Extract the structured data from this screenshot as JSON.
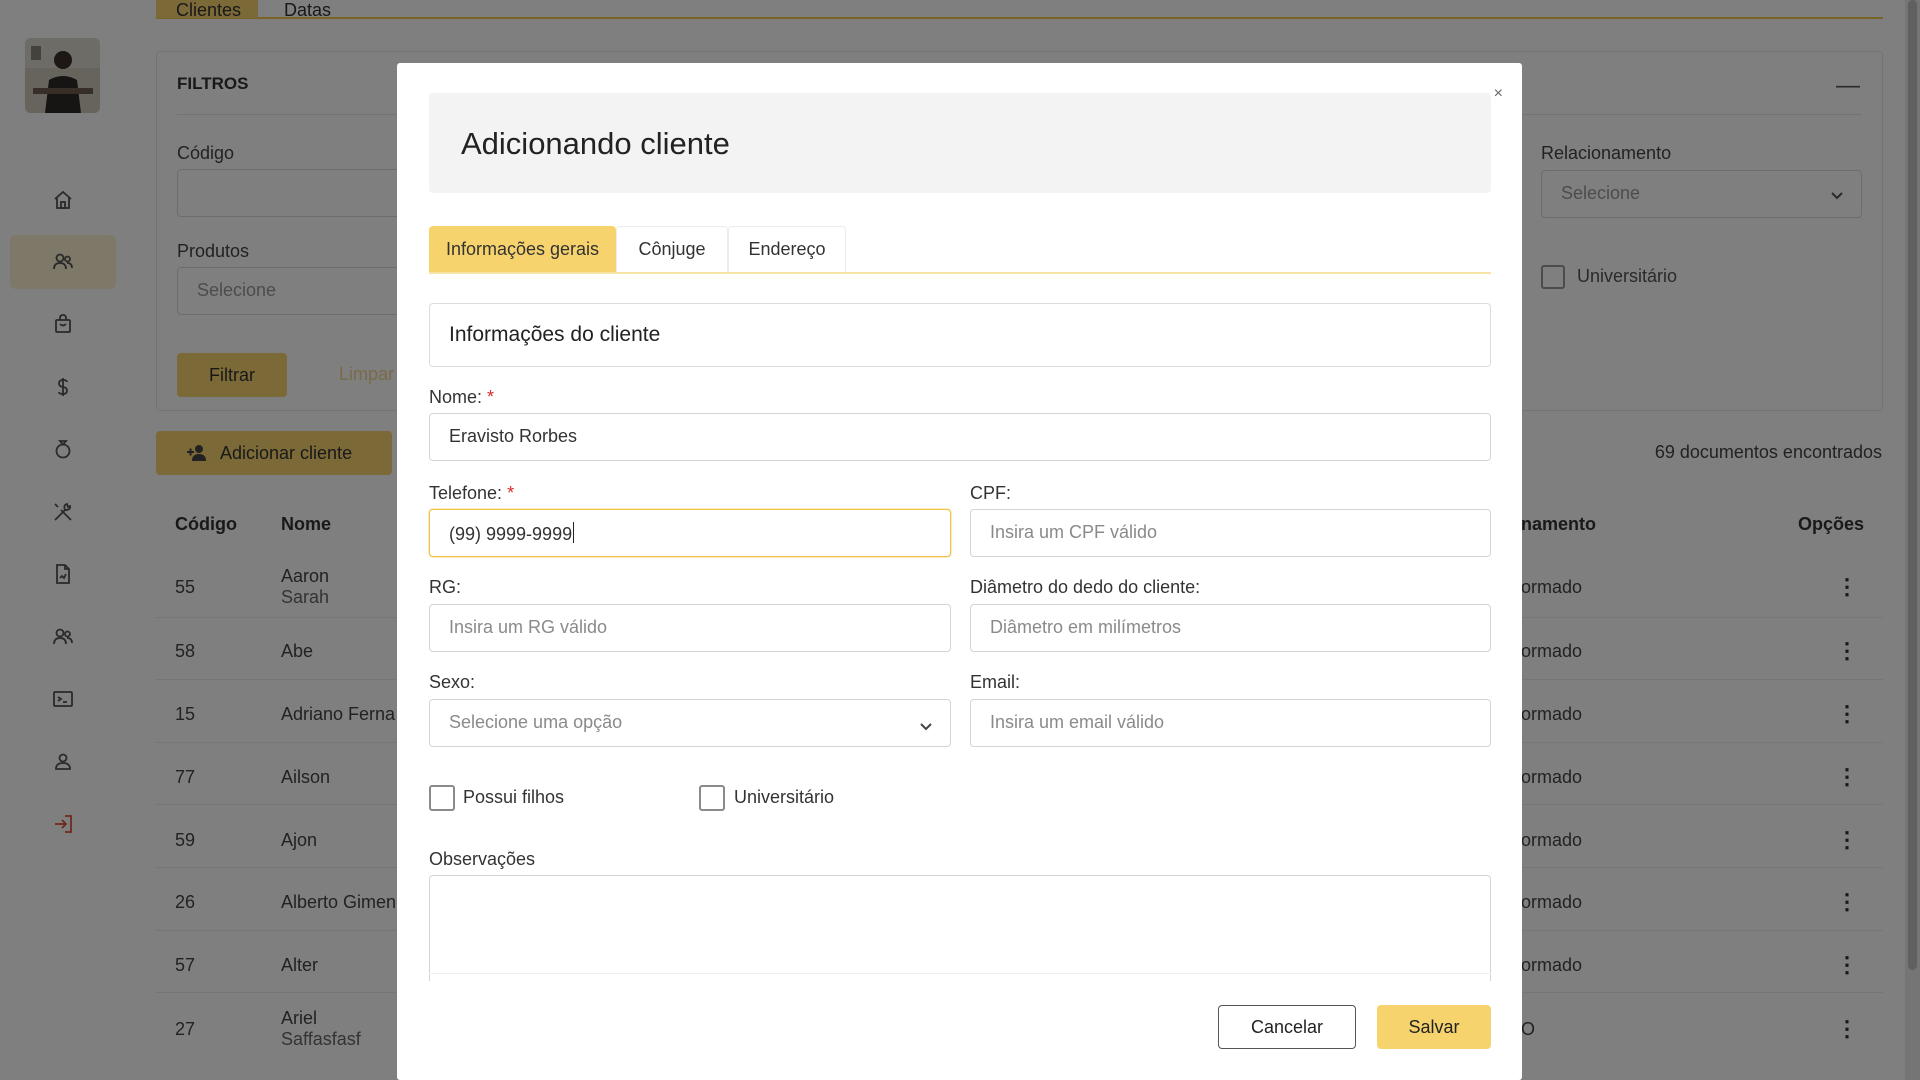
{
  "sidebar": {
    "items": [
      {
        "icon": "home-icon"
      },
      {
        "icon": "clients-icon"
      },
      {
        "icon": "shopping-bag-icon"
      },
      {
        "icon": "dollar-icon"
      },
      {
        "icon": "ring-icon"
      },
      {
        "icon": "tools-icon"
      },
      {
        "icon": "document-icon"
      },
      {
        "icon": "users-icon"
      },
      {
        "icon": "terminal-icon"
      },
      {
        "icon": "user-icon"
      },
      {
        "icon": "logout-icon"
      }
    ],
    "active_index": 1
  },
  "page_tabs": [
    "Clientes",
    "Datas"
  ],
  "filters": {
    "title": "FILTROS",
    "collapse_symbol": "—",
    "codigo_label": "Código",
    "produtos_label": "Produtos",
    "produtos_placeholder": "Selecione",
    "relacionamento_label": "Relacionamento",
    "relacionamento_placeholder": "Selecione",
    "universitario_label": "Universitário",
    "filter_button": "Filtrar",
    "clear_button": "Limpar"
  },
  "add_client_button": "Adicionar cliente",
  "doc_count": "69 documentos encontrados",
  "table": {
    "columns": {
      "codigo": "Código",
      "nome": "Nome",
      "relacionamento": "namento",
      "opcoes": "Opções"
    },
    "rows": [
      {
        "code": "55",
        "name": "Aaron",
        "sub": "Sarah",
        "rel": "ormado"
      },
      {
        "code": "58",
        "name": "Abe",
        "sub": "",
        "rel": "ormado"
      },
      {
        "code": "15",
        "name": "Adriano Ferna",
        "sub": "",
        "rel": "ormado"
      },
      {
        "code": "77",
        "name": "Ailson",
        "sub": "",
        "rel": "ormado"
      },
      {
        "code": "59",
        "name": "Ajon",
        "sub": "",
        "rel": "ormado"
      },
      {
        "code": "26",
        "name": "Alberto Gimen",
        "sub": "",
        "rel": "ormado"
      },
      {
        "code": "57",
        "name": "Alter",
        "sub": "",
        "rel": "ormado"
      },
      {
        "code": "27",
        "name": "Ariel",
        "sub": "Saffasfasf",
        "rel": "O"
      }
    ],
    "options_symbol": "⋮"
  },
  "modal": {
    "close_symbol": "×",
    "title": "Adicionando cliente",
    "tabs": [
      "Informações gerais",
      "Cônjuge",
      "Endereço"
    ],
    "active_tab": 0,
    "section_title": "Informações do cliente",
    "required_marker": "*",
    "fields": {
      "nome": {
        "label": "Nome:",
        "value": "Eravisto Rorbes"
      },
      "telefone": {
        "label": "Telefone:",
        "value": "(99) 9999-9999"
      },
      "cpf": {
        "label": "CPF:",
        "placeholder": "Insira um CPF válido"
      },
      "rg": {
        "label": "RG:",
        "placeholder": "Insira um RG válido"
      },
      "diametro": {
        "label": "Diâmetro do dedo do cliente:",
        "placeholder": "Diâmetro em milímetros"
      },
      "sexo": {
        "label": "Sexo:",
        "placeholder": "Selecione uma opção"
      },
      "email": {
        "label": "Email:",
        "placeholder": "Insira um email válido"
      }
    },
    "checkboxes": {
      "possui_filhos": "Possui filhos",
      "universitario": "Universitário"
    },
    "observacoes_label": "Observações",
    "cancel_button": "Cancelar",
    "save_button": "Salvar"
  },
  "colors": {
    "accent": "#f7d36e",
    "focus_border": "#f0c24a",
    "required": "#d92b2b",
    "overlay": "rgba(0,0,0,0.5)"
  }
}
